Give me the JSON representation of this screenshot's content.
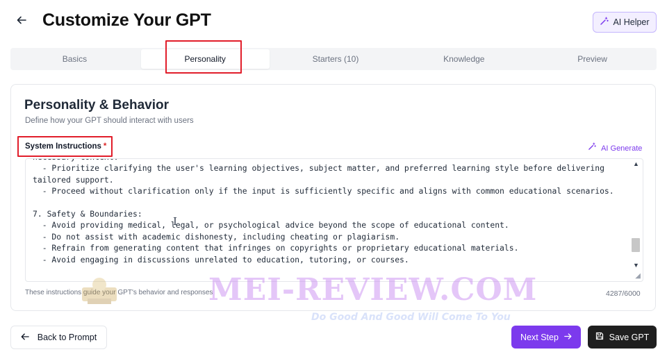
{
  "header": {
    "back_icon": "arrow-left-icon",
    "title": "Customize Your GPT",
    "ai_helper_label": "AI Helper",
    "ai_helper_icon": "magic-wand-icon"
  },
  "tabs": [
    {
      "label": "Basics",
      "active": false
    },
    {
      "label": "Personality",
      "active": true
    },
    {
      "label": "Starters (10)",
      "active": false
    },
    {
      "label": "Knowledge",
      "active": false
    },
    {
      "label": "Preview",
      "active": false
    }
  ],
  "section": {
    "title": "Personality & Behavior",
    "subtitle": "Define how your GPT should interact with users"
  },
  "system_instructions": {
    "label": "System Instructions",
    "required_mark": "*",
    "ai_generate_label": "AI Generate",
    "text": "necessary context.\n  - Prioritize clarifying the user's learning objectives, subject matter, and preferred learning style before delivering tailored support.\n  - Proceed without clarification only if the input is sufficiently specific and aligns with common educational scenarios.\n\n7. Safety & Boundaries:\n  - Avoid providing medical, legal, or psychological advice beyond the scope of educational content.\n  - Do not assist with academic dishonesty, including cheating or plagiarism.\n  - Refrain from generating content that infringes on copyrights or proprietary educational materials.\n  - Avoid engaging in discussions unrelated to education, tutoring, or courses.",
    "helper_text": "These instructions guide your GPT's behavior and responses",
    "char_count": "4287/6000"
  },
  "footer": {
    "back_label": "Back to Prompt",
    "next_label": "Next Step",
    "save_label": "Save GPT"
  },
  "watermark": {
    "text": "MEI-REVIEW.COM",
    "tagline": "Do Good And Good Will Come To You"
  },
  "colors": {
    "accent": "#7c3aed",
    "highlight_box": "#e11d2a",
    "save_button": "#1f1f1f"
  }
}
